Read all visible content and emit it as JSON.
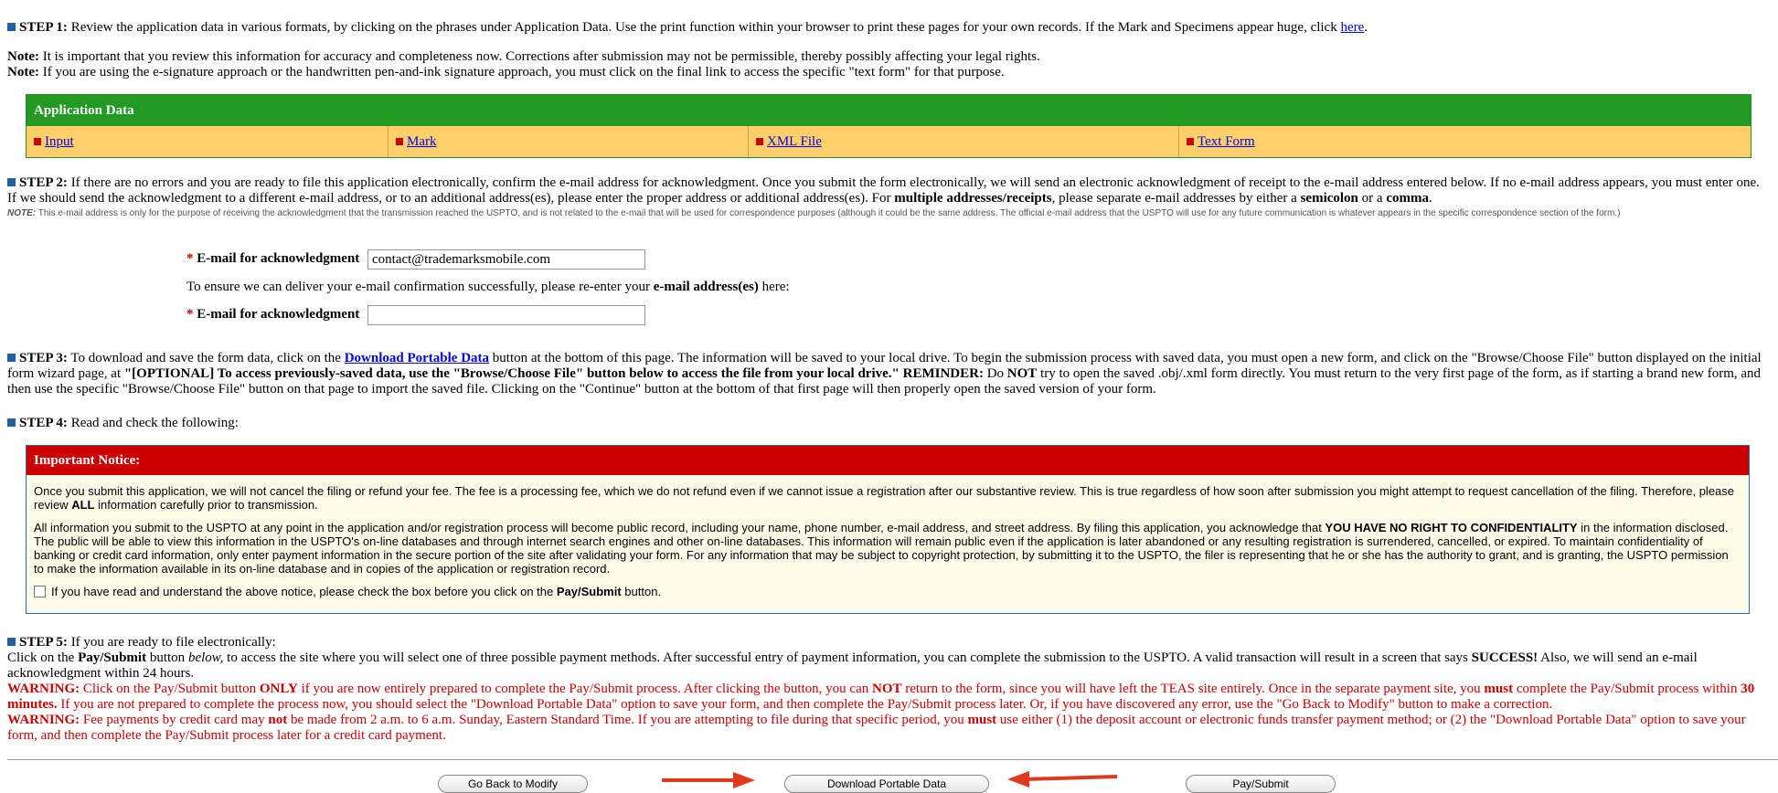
{
  "step1": {
    "label": "STEP 1:",
    "text": " Review the application data in various formats, by clicking on the phrases under Application Data. Use the print function within your browser to print these pages for your own records. If the Mark and Specimens appear huge, click ",
    "link": "here",
    "end": "."
  },
  "notes": {
    "note_label": "Note:",
    "note1": " It is important that you review this information for accuracy and completeness now. Corrections after submission may not be permissible, thereby possibly affecting your legal rights.",
    "note2": " If you are using the e-signature approach or the handwritten pen-and-ink signature approach, you must click on the final link to access the specific \"text form\" for that purpose."
  },
  "app_data": {
    "header": "Application Data",
    "links": [
      "Input",
      "Mark",
      "XML File",
      "Text Form"
    ]
  },
  "step2": {
    "label": "STEP 2:",
    "text_a": " If there are no errors and you are ready to file this application electronically, confirm the e-mail address for acknowledgment. Once you submit the form electronically, we will send an electronic acknowledgment of receipt to the e-mail address entered below. If no e-mail address appears, you must enter one. If we should send the acknowledgment to a different e-mail address, or to an additional address(es), please enter the proper address or additional address(es). For ",
    "bold1": "multiple addresses/receipts",
    "text_b": ", please separate e-mail addresses by either a ",
    "bold2": "semicolon",
    "text_c": " or a ",
    "bold3": "comma",
    "text_d": ".",
    "note_label": "NOTE:",
    "note": " This e-mail address is only for the purpose of receiving the acknowledgment that the transmission reached the USPTO, and is not related to the e-mail that will be used for correspondence purposes (although it could be the same address. The official e-mail address that the USPTO will use for any future communication is whatever appears in the specific correspondence section of the form.)"
  },
  "email": {
    "required_mark": "*",
    "label": "E-mail for acknowledgment",
    "value": "contact@trademarksmobile.com",
    "reenter_text": "To ensure we can deliver your e-mail confirmation successfully, please re-enter your ",
    "reenter_bold": "e-mail address(es)",
    "reenter_end": " here:",
    "confirm_value": ""
  },
  "step3": {
    "label": "STEP 3:",
    "text_a": " To download and save the form data, click on the ",
    "link": "Download Portable Data",
    "text_b": " button at the bottom of this page. The information will be saved to your local drive. To begin the submission process with saved data, you must open a new form, and click on the \"Browse/Choose File\" button displayed on the initial form wizard page, at ",
    "bold1": "\"[OPTIONAL] To access previously-saved data, use the \"Browse/Choose File\" button below to access the file from your local drive.\" REMINDER:",
    "text_c": " Do ",
    "bold2": "NOT",
    "text_d": " try to open the saved .obj/.xml form directly. You must return to the very first page of the form, as if starting a brand new form, and then use the specific \"Browse/Choose File\" button on that page to import the saved file. Clicking on the \"Continue\" button at the bottom of that first page will then properly open the saved version of your form."
  },
  "step4": {
    "label": "STEP 4:",
    "text": " Read and check the following:"
  },
  "notice": {
    "header": "Important Notice:",
    "p1_a": "Once you submit this application, we will not cancel the filing or refund your fee. The fee is a processing fee, which we do not refund even if we cannot issue a registration after our substantive review. This is true regardless of how soon after submission you might attempt to request cancellation of the filing. Therefore, please review ",
    "p1_bold": "ALL",
    "p1_b": " information carefully prior to transmission.",
    "p2_a": "All information you submit to the USPTO at any point in the application and/or registration process will become public record, including your name, phone number, e-mail address, and street address. By filing this application, you acknowledge that ",
    "p2_bold": "YOU HAVE NO RIGHT TO CONFIDENTIALITY",
    "p2_b": " in the information disclosed. The public will be able to view this information in the USPTO's on-line databases and through internet search engines and other on-line databases. This information will remain public even if the application is later abandoned or any resulting registration is surrendered, cancelled, or expired. To maintain confidentiality of banking or credit card information, only enter payment information in the secure portion of the site after validating your form. For any information that may be subject to copyright protection, by submitting it to the USPTO, the filer is representing that he or she has the authority to grant, and is granting, the USPTO permission to make the information available in its on-line database and in copies of the application or registration record.",
    "check_a": "If you have read and understand the above notice, please check the box before you click on the ",
    "check_bold": "Pay/Submit",
    "check_b": " button."
  },
  "step5": {
    "label": "STEP 5:",
    "text": " If you are ready to file electronically:",
    "line_a": "Click on the ",
    "line_bold1": "Pay/Submit",
    "line_b": " button ",
    "line_ital": "below,",
    "line_c": " to access the site where you will select one of three possible payment methods. After successful entry of payment information, you can complete the submission to the USPTO. A valid transaction will result in a screen that says ",
    "line_bold2": "SUCCESS!",
    "line_d": " Also, we will send an e-mail acknowledgment within 24 hours.",
    "warn_label": "WARNING:",
    "w1_a": " Click on the Pay/Submit button ",
    "w1_bold1": "ONLY",
    "w1_b": " if you are now entirely prepared to complete the Pay/Submit process. After clicking the button, you can ",
    "w1_bold2": "NOT",
    "w1_c": " return to the form, since you will have left the TEAS site entirely. Once in the separate payment site, you ",
    "w1_bold3": "must",
    "w1_d": " complete the Pay/Submit process within ",
    "w1_bold4": "30 minutes.",
    "w1_e": " If you are not prepared to complete the process now, you should select the \"Download Portable Data\" option to save your form, and then complete the Pay/Submit process later. Or, if you have discovered any error, use the \"Go Back to Modify\" button to make a correction.",
    "w2_a": " Fee payments by credit card may ",
    "w2_bold1": "not",
    "w2_b": " be made from 2 a.m. to 6 a.m. Sunday, Eastern Standard Time. If you are attempting to file during that specific period, you ",
    "w2_bold2": "must",
    "w2_c": " use either (1) the deposit account or electronic funds transfer payment method; or (2) the \"Download Portable Data\" option to save your form, and then complete the Pay/Submit process later for a credit card payment."
  },
  "buttons": {
    "back": "Go Back to Modify",
    "download": "Download Portable Data",
    "submit": "Pay/Submit"
  },
  "colors": {
    "accent_green": "#229922",
    "table_row": "#ffd06a",
    "notice_red": "#cc0000",
    "arrow_red": "#e03a1e"
  }
}
